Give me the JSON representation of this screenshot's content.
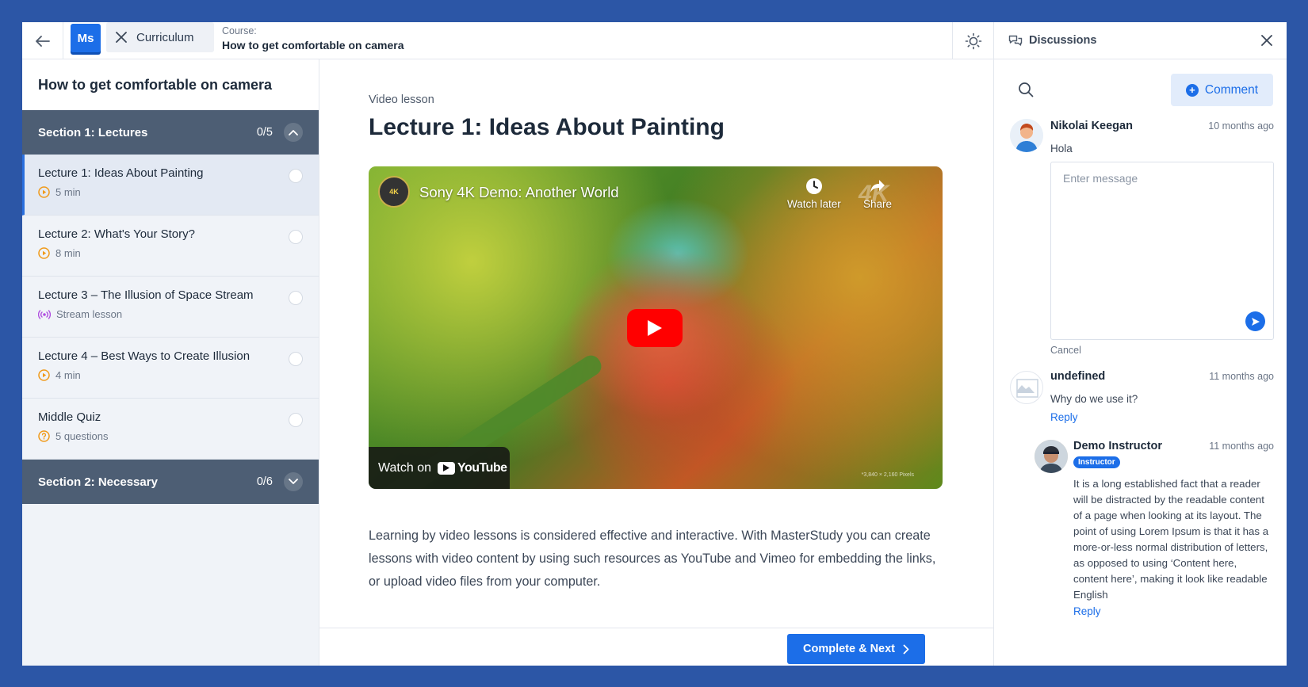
{
  "topbar": {
    "logo": "Ms",
    "curriculum_label": "Curriculum",
    "course_label": "Course:",
    "course_title": "How to get comfortable on camera"
  },
  "sidebar": {
    "title": "How to get comfortable on camera",
    "sections": [
      {
        "title": "Section 1: Lectures",
        "count": "0/5",
        "expanded": true
      },
      {
        "title": "Section 2: Necessary",
        "count": "0/6",
        "expanded": false
      }
    ],
    "lessons": [
      {
        "title": "Lecture 1: Ideas About Painting",
        "meta": "5 min",
        "icon": "play-circle-icon",
        "active": true
      },
      {
        "title": "Lecture 2: What's Your Story?",
        "meta": "8 min",
        "icon": "play-circle-icon"
      },
      {
        "title": "Lecture 3 – The Illusion of Space Stream",
        "meta": "Stream lesson",
        "icon": "broadcast-icon"
      },
      {
        "title": "Lecture 4 – Best Ways to Create Illusion",
        "meta": "4 min",
        "icon": "play-circle-icon"
      },
      {
        "title": "Middle Quiz",
        "meta": "5 questions",
        "icon": "question-circle-icon"
      }
    ]
  },
  "main": {
    "lesson_type": "Video lesson",
    "title": "Lecture 1: Ideas About Painting",
    "video": {
      "channel_badge": "4K",
      "title": "Sony 4K Demo: Another World",
      "watch_later": "Watch later",
      "share": "Share",
      "watermark": "4K",
      "watch_on": "Watch on",
      "youtube": "YouTube",
      "resolution": "*3,840 × 2,160 Pixels"
    },
    "description": "Learning by video lessons is considered effective and interactive. With MasterStudy you can create lessons with video content by using such resources as YouTube and Vimeo for embedding the links, or upload video files from your computer.",
    "complete_button": "Complete & Next"
  },
  "discussions": {
    "title": "Discussions",
    "comment_button": "Comment",
    "message_placeholder": "Enter message",
    "cancel": "Cancel",
    "comments": [
      {
        "author": "Nikolai Keegan",
        "time": "10 months ago",
        "text": "Hola"
      },
      {
        "author": "undefined",
        "time": "11 months ago",
        "text": "Why do we use it?",
        "reply": "Reply"
      },
      {
        "author": "Demo Instructor",
        "time": "11 months ago",
        "badge": "Instructor",
        "text": "It is a long established fact that a reader will be distracted by the readable content of a page when looking at its layout. The point of using Lorem Ipsum is that it has a more-or-less normal distribution of letters, as opposed to using ‘Content here, content here’, making it look like readable English",
        "reply": "Reply"
      }
    ]
  },
  "colors": {
    "accent": "#1c6ee8",
    "section_header": "#4d5e74",
    "background": "#2c56a6",
    "lesson_icon_orange": "#f09a1a",
    "stream_icon_purple": "#b04fe0"
  }
}
